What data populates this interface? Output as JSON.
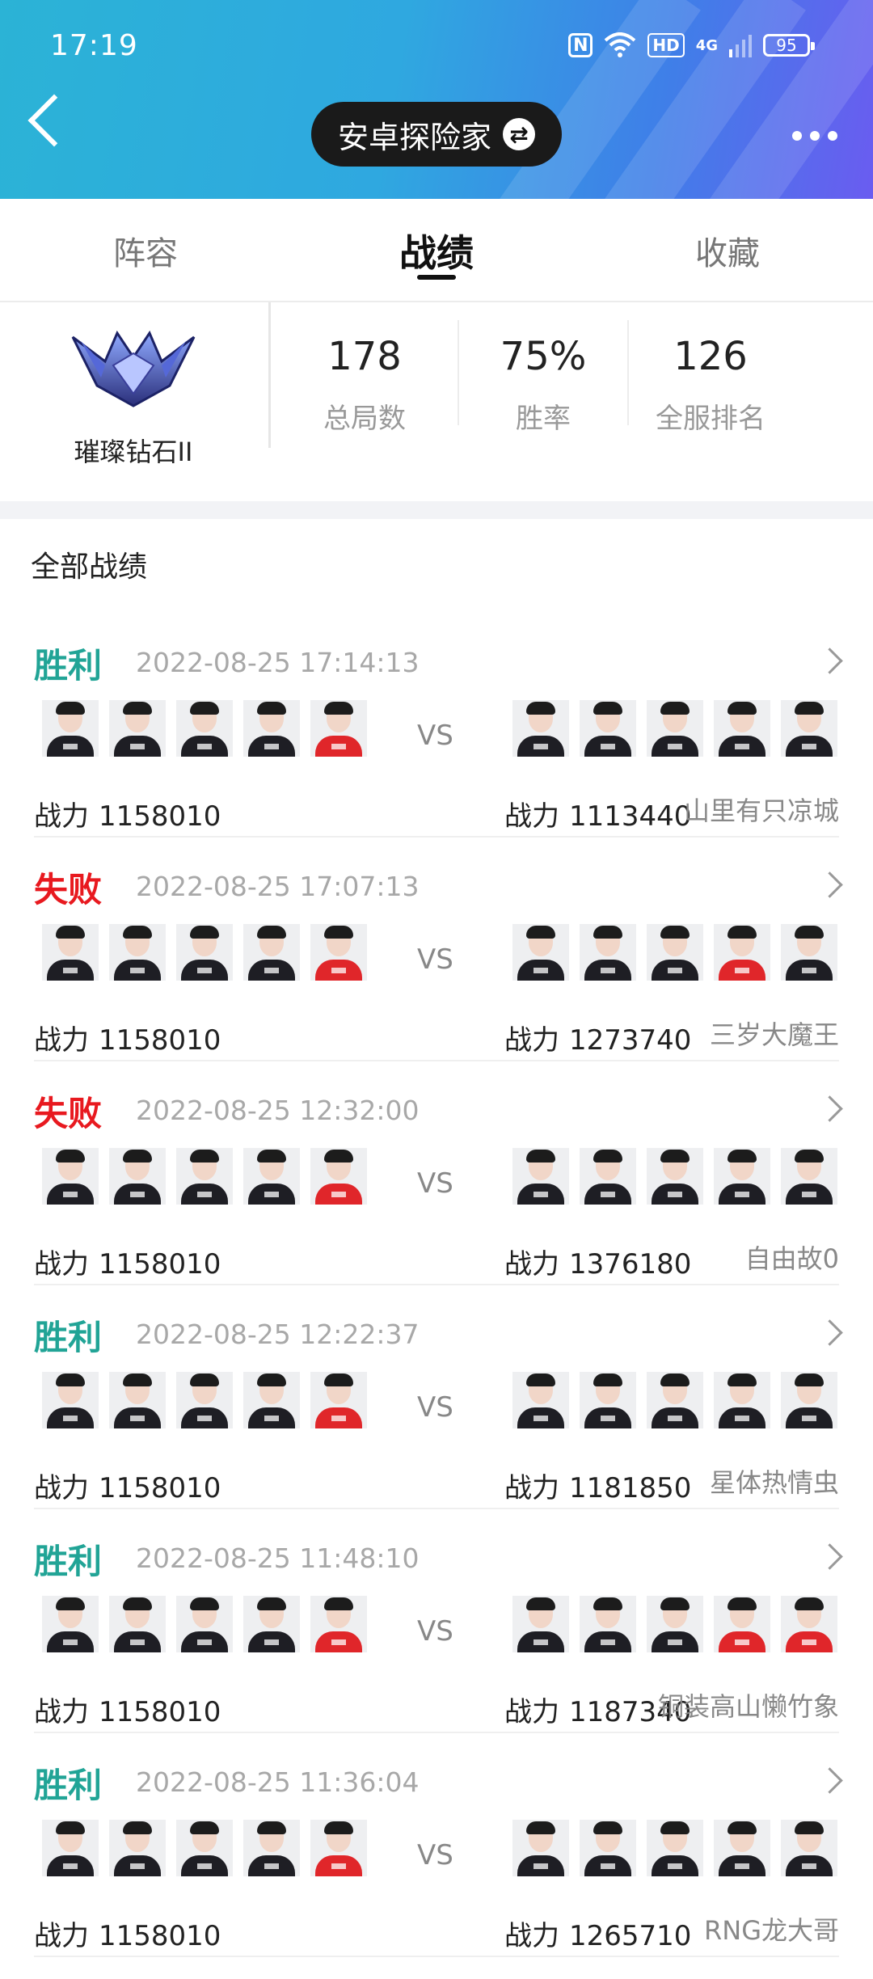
{
  "status_bar": {
    "time": "17:19",
    "nfc": "N",
    "hd": "HD",
    "network": "4G",
    "battery": "95"
  },
  "header": {
    "title": "安卓探险家",
    "swap_glyph": "⇄"
  },
  "tabs": [
    {
      "label": "阵容",
      "active": false
    },
    {
      "label": "战绩",
      "active": true
    },
    {
      "label": "收藏",
      "active": false
    }
  ],
  "rank": {
    "name": "璀璨钻石II"
  },
  "stats": [
    {
      "value": "178",
      "label": "总局数"
    },
    {
      "value": "75%",
      "label": "胜率"
    },
    {
      "value": "126",
      "label": "全服排名"
    }
  ],
  "section_title": "全部战绩",
  "vs_label": "VS",
  "power_label": "战力",
  "colors": {
    "win": "#21a496",
    "lose": "#e8191f",
    "jersey_dark": "#1e1e24",
    "jersey_red": "#e0262a"
  },
  "records": [
    {
      "result": "胜利",
      "outcome": "win",
      "time": "2022-08-25 17:14:13",
      "my_power": "1158010",
      "opp_power": "1113440",
      "opp_name": "山里有只凉城",
      "my_jerseys": [
        "dark",
        "dark",
        "dark",
        "dark",
        "red"
      ],
      "opp_jerseys": [
        "dark",
        "dark",
        "dark",
        "dark",
        "dark"
      ]
    },
    {
      "result": "失败",
      "outcome": "lose",
      "time": "2022-08-25 17:07:13",
      "my_power": "1158010",
      "opp_power": "1273740",
      "opp_name": "三岁大魔王",
      "my_jerseys": [
        "dark",
        "dark",
        "dark",
        "dark",
        "red"
      ],
      "opp_jerseys": [
        "dark",
        "dark",
        "dark",
        "red",
        "dark"
      ]
    },
    {
      "result": "失败",
      "outcome": "lose",
      "time": "2022-08-25 12:32:00",
      "my_power": "1158010",
      "opp_power": "1376180",
      "opp_name": "自由故0",
      "my_jerseys": [
        "dark",
        "dark",
        "dark",
        "dark",
        "red"
      ],
      "opp_jerseys": [
        "dark",
        "dark",
        "dark",
        "dark",
        "dark"
      ]
    },
    {
      "result": "胜利",
      "outcome": "win",
      "time": "2022-08-25 12:22:37",
      "my_power": "1158010",
      "opp_power": "1181850",
      "opp_name": "星体热情虫",
      "my_jerseys": [
        "dark",
        "dark",
        "dark",
        "dark",
        "red"
      ],
      "opp_jerseys": [
        "dark",
        "dark",
        "dark",
        "dark",
        "dark"
      ]
    },
    {
      "result": "胜利",
      "outcome": "win",
      "time": "2022-08-25 11:48:10",
      "my_power": "1158010",
      "opp_power": "1187340",
      "opp_name": "铜装高山懒竹象",
      "my_jerseys": [
        "dark",
        "dark",
        "dark",
        "dark",
        "red"
      ],
      "opp_jerseys": [
        "dark",
        "dark",
        "dark",
        "red",
        "red"
      ]
    },
    {
      "result": "胜利",
      "outcome": "win",
      "time": "2022-08-25 11:36:04",
      "my_power": "1158010",
      "opp_power": "1265710",
      "opp_name": "RNG龙大哥",
      "my_jerseys": [
        "dark",
        "dark",
        "dark",
        "dark",
        "red"
      ],
      "opp_jerseys": [
        "dark",
        "dark",
        "dark",
        "dark",
        "dark"
      ]
    }
  ]
}
